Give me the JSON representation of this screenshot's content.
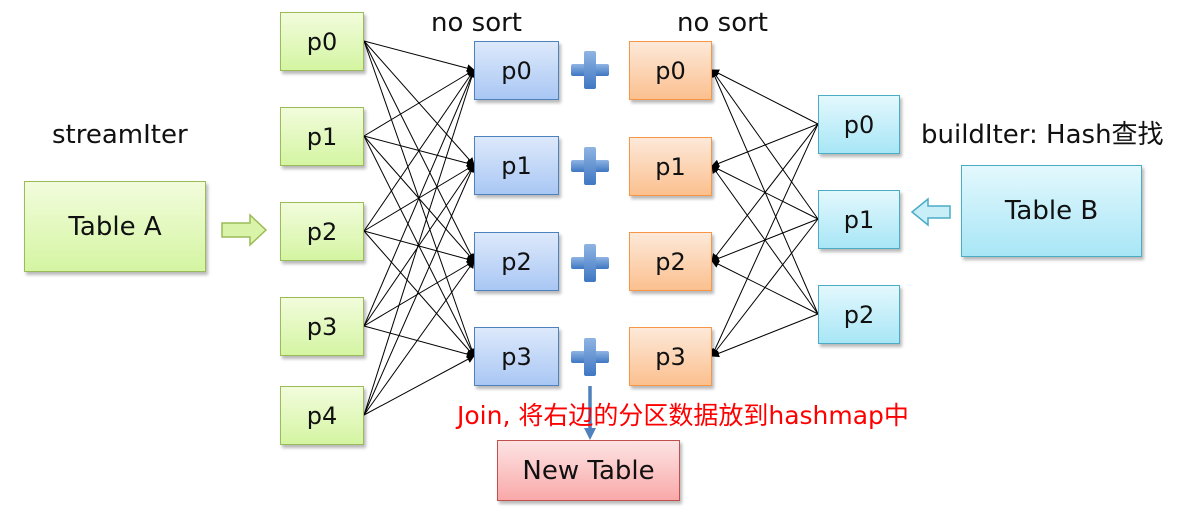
{
  "title_left": "streamIter",
  "title_right": "buildIter: Hash查找",
  "left_sort_label": "no sort",
  "right_sort_label": "no sort",
  "table_a": {
    "label": "Table A",
    "color": "#d4f5a2"
  },
  "table_b": {
    "label": "Table B",
    "color": "#a8e6f6"
  },
  "new_table": {
    "label": "New Table",
    "color": "#f9a9a9"
  },
  "join_note": "Join, 将右边的分区数据放到hashmap中",
  "stream_partitions": [
    {
      "label": "p0"
    },
    {
      "label": "p1"
    },
    {
      "label": "p2"
    },
    {
      "label": "p3"
    },
    {
      "label": "p4"
    }
  ],
  "stream_shuffled": [
    {
      "label": "p0"
    },
    {
      "label": "p1"
    },
    {
      "label": "p2"
    },
    {
      "label": "p3"
    }
  ],
  "build_shuffled": [
    {
      "label": "p0"
    },
    {
      "label": "p1"
    },
    {
      "label": "p2"
    },
    {
      "label": "p3"
    }
  ],
  "build_partitions": [
    {
      "label": "p0"
    },
    {
      "label": "p1"
    },
    {
      "label": "p2"
    }
  ],
  "join_operator_icon": "plus-icon",
  "colors": {
    "stream": "#9bbb59",
    "shuffled_stream": "#4f81bd",
    "shuffled_build": "#f79646",
    "build": "#4bacc6",
    "new_table": "#c0504d",
    "note": "#ff0000"
  }
}
